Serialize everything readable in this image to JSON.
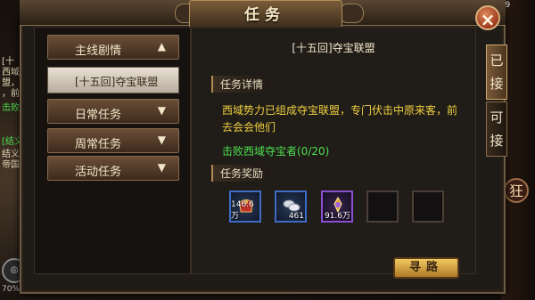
{
  "window": {
    "title": "任务",
    "close_label": "×"
  },
  "sidebar": {
    "main_category": {
      "label": "主线剧情",
      "arrow": "▲"
    },
    "current_quest": {
      "label": "[十五回]夺宝联盟"
    },
    "categories": [
      {
        "label": "日常任务",
        "arrow": "▼"
      },
      {
        "label": "周常任务",
        "arrow": "▼"
      },
      {
        "label": "活动任务",
        "arrow": "▼"
      }
    ]
  },
  "quest": {
    "title": "[十五回]夺宝联盟",
    "details_header": "任务详情",
    "description": "西域势力已组成夺宝联盟，专门伏击中原来客，前去会会他们",
    "objective": "击败西域夺宝者(0/20)",
    "rewards_header": "任务奖励",
    "rewards": [
      {
        "icon": "red-gift-bag-icon",
        "quantity": "146.6万",
        "rarity": "blue"
      },
      {
        "icon": "silver-ingots-icon",
        "quantity": "461",
        "rarity": "blue"
      },
      {
        "icon": "purple-potion-icon",
        "quantity": "91.6万",
        "rarity": "purple"
      },
      {
        "icon": "empty-slot",
        "quantity": "",
        "rarity": "none"
      },
      {
        "icon": "empty-slot",
        "quantity": "",
        "rarity": "none"
      }
    ],
    "find_path_label": "寻路"
  },
  "right_tabs": [
    {
      "label_top": "已",
      "label_bottom": "接",
      "active": true
    },
    {
      "label_top": "可",
      "label_bottom": "接",
      "active": false
    }
  ],
  "background": {
    "chat_lines": [
      "[十",
      "西域势",
      "盟，专",
      "，前去",
      "击败西",
      "[结义]",
      "结义成",
      "帝国"
    ],
    "top_right_number": "339",
    "side_button_label": "狂",
    "level_text": "70%"
  },
  "colors": {
    "description_text": "#f0d040",
    "objective_text": "#4ee04e",
    "accent_gold": "#b48a50"
  }
}
